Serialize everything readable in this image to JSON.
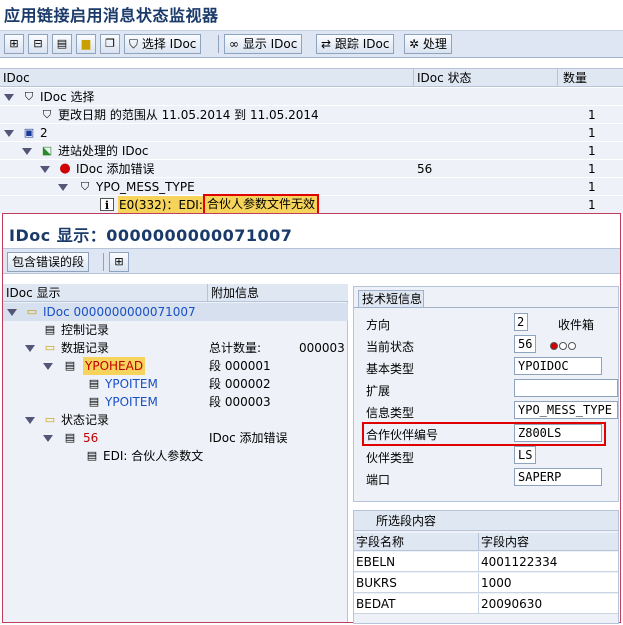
{
  "window": {
    "title": "应用链接启用消息状态监视器"
  },
  "toolbar": {
    "select_label": "选择 IDoc",
    "display_label": "显示 IDoc",
    "trace_label": "跟踪 IDoc",
    "process_label": "处理"
  },
  "grid": {
    "columns": [
      "IDoc",
      "IDoc 状态",
      "数量"
    ],
    "rows": [
      {
        "label": "IDoc 选择",
        "status": "",
        "count": ""
      },
      {
        "label": "更改日期 的范围从 11.05.2014 到 11.05.2014",
        "status": "",
        "count": "1"
      },
      {
        "label": "2",
        "status": "",
        "count": "1"
      },
      {
        "label": "进站处理的 IDoc",
        "status": "",
        "count": "1"
      },
      {
        "label": "IDoc 添加错误",
        "status": "56",
        "count": "1"
      },
      {
        "label": "YPO_MESS_TYPE",
        "status": "",
        "count": "1"
      },
      {
        "label": "E0(332)：EDI:",
        "highlight": "合伙人参数文件无效",
        "status": "",
        "count": "1"
      }
    ]
  },
  "idoc_display": {
    "title": "IDoc 显示：0000000000071007",
    "toolbar": {
      "error_segments_label": "包含错误的段"
    },
    "tree_columns": [
      "IDoc 显示",
      "附加信息"
    ],
    "tree": [
      {
        "label": "IDoc 0000000000071007",
        "info": "",
        "info2": ""
      },
      {
        "label": "控制记录",
        "info": "",
        "info2": ""
      },
      {
        "label": "数据记录",
        "info": "总计数量:",
        "info2": "000003"
      },
      {
        "label": "YPOHEAD",
        "info": "段 000001",
        "info2": ""
      },
      {
        "label": "YPOITEM",
        "info": "段 000002",
        "info2": ""
      },
      {
        "label": "YPOITEM",
        "info": "段 000003",
        "info2": ""
      },
      {
        "label": "状态记录",
        "info": "",
        "info2": ""
      },
      {
        "label": "56",
        "info": "IDoc 添加错误",
        "info2": ""
      },
      {
        "label": "EDI: 合伙人参数文",
        "info": "",
        "info2": ""
      }
    ],
    "short_info": {
      "tab_label": "技术短信息",
      "fields": [
        {
          "label": "方向",
          "value": "2",
          "extra": "收件箱"
        },
        {
          "label": "当前状态",
          "value": "56",
          "extra": ""
        },
        {
          "label": "基本类型",
          "value": "YPOIDOC",
          "extra": ""
        },
        {
          "label": "扩展",
          "value": "",
          "extra": ""
        },
        {
          "label": "信息类型",
          "value": "YPO_MESS_TYPE",
          "extra": ""
        },
        {
          "label": "合作伙伴编号",
          "value": "Z800LS",
          "extra": ""
        },
        {
          "label": "伙伴类型",
          "value": "LS",
          "extra": ""
        },
        {
          "label": "端口",
          "value": "SAPERP",
          "extra": ""
        }
      ]
    },
    "segment_content": {
      "title": "所选段内容",
      "columns": [
        "字段名称",
        "字段内容"
      ],
      "rows": [
        {
          "name": "EBELN",
          "value": "4001122334"
        },
        {
          "name": "BUKRS",
          "value": "1000"
        },
        {
          "name": "BEDAT",
          "value": "20090630"
        }
      ]
    }
  },
  "colors": {
    "header_blue": "#1a3a6a",
    "error_red": "#e00000",
    "link_blue": "#1a4fc4"
  }
}
